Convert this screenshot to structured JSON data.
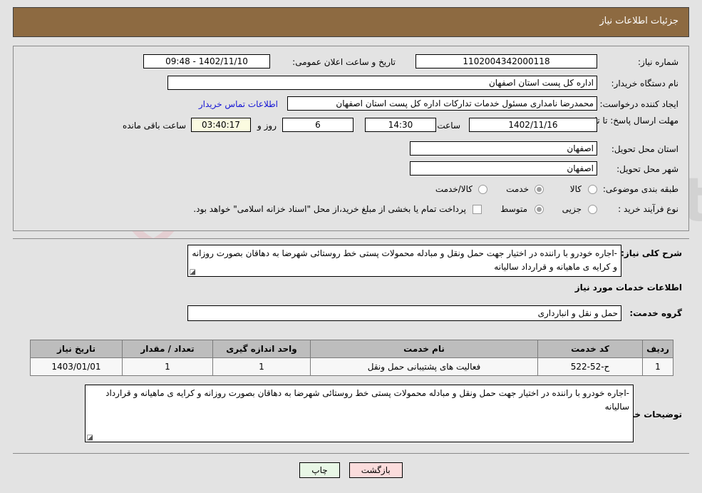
{
  "header": {
    "title": "جزئیات اطلاعات نیاز",
    "bg_color": "#8d6a41"
  },
  "form": {
    "need_number_label": "شماره نیاز:",
    "need_number_value": "1102004342000118",
    "announce_label": "تاریخ و ساعت اعلان عمومی:",
    "announce_value": "1402/11/10 - 09:48",
    "buyer_org_label": "نام دستگاه خریدار:",
    "buyer_org_value": "اداره کل پست استان اصفهان",
    "creator_label": "ایجاد کننده درخواست:",
    "creator_value": "محمدرضا نامداری مسئول خدمات تدارکات اداره کل پست استان اصفهان",
    "contact_link": "اطلاعات تماس خریدار",
    "deadline_label": "مهلت ارسال پاسخ: تا تاریخ:",
    "deadline_date": "1402/11/16",
    "hour_label": "ساعت",
    "hour_value": "14:30",
    "days_value": "6",
    "days_label": "روز و",
    "countdown_value": "03:40:17",
    "countdown_label": "ساعت باقی مانده",
    "province_label": "استان محل تحویل:",
    "province_value": "اصفهان",
    "city_label": "شهر محل تحویل:",
    "city_value": "اصفهان",
    "category_label": "طبقه بندی موضوعی:",
    "category_options": [
      {
        "label": "کالا",
        "selected": false
      },
      {
        "label": "خدمت",
        "selected": true
      },
      {
        "label": "کالا/خدمت",
        "selected": false
      }
    ],
    "process_label": "نوع فرآیند خرید :",
    "process_options": [
      {
        "label": "جزیی",
        "selected": false
      },
      {
        "label": "متوسط",
        "selected": true
      }
    ],
    "treasury_checkbox_label": "پرداخت تمام یا بخشی از مبلغ خرید،از محل \"اسناد خزانه اسلامی\" خواهد بود.",
    "treasury_checked": false
  },
  "description": {
    "label": "شرح کلی نیاز:",
    "value": "-اجاره خودرو با راننده در اختیار جهت حمل ونقل و مبادله محمولات  پستی خط روستائی شهرضا به دهاقان بصورت روزانه و کرایه ی ماهیانه و قرارداد سالیانه"
  },
  "services": {
    "section_title": "اطلاعات خدمات مورد نیاز",
    "group_label": "گروه خدمت:",
    "group_value": "حمل و نقل و انبارداری",
    "columns": [
      "ردیف",
      "کد خدمت",
      "نام خدمت",
      "واحد اندازه گیری",
      "تعداد / مقدار",
      "تاریخ نیاز"
    ],
    "rows": [
      {
        "row_no": "1",
        "code": "ح-52-522",
        "name": "فعالیت های پشتیبانی حمل ونقل",
        "unit": "1",
        "qty": "1",
        "need_date": "1403/01/01"
      }
    ]
  },
  "buyer_notes": {
    "label": "توضیحات خریدار:",
    "value": "-اجاره خودرو با راننده در اختیار جهت حمل ونقل و مبادله محمولات  پستی خط روستائی شهرضا به دهاقان بصورت روزانه و کرایه ی ماهیانه و قرارداد سالیانه"
  },
  "buttons": {
    "print": "چاپ",
    "back": "بازگشت"
  },
  "watermark": {
    "text": "AriaTender.net"
  }
}
